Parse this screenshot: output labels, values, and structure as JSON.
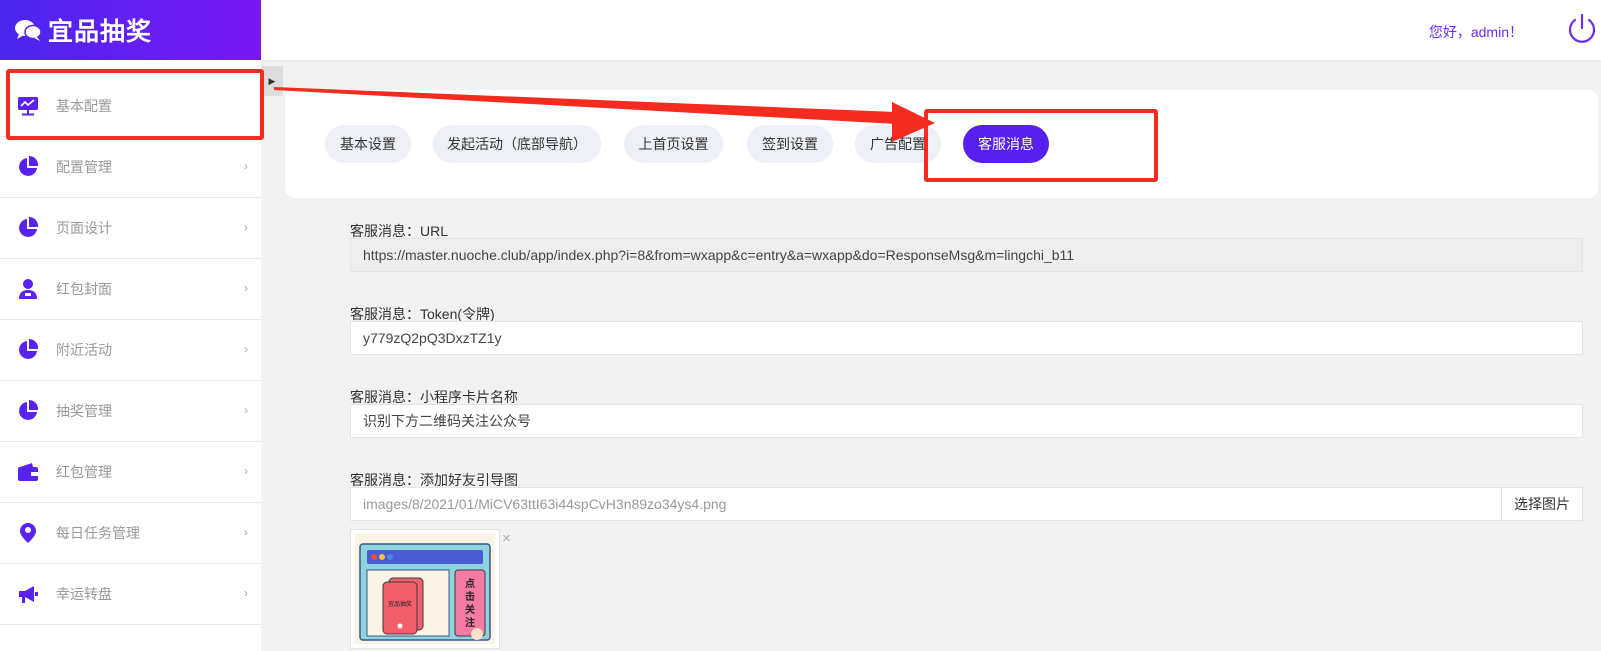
{
  "brand": {
    "title": "宜品抽奖",
    "icon": "chat-bubbles-icon"
  },
  "header": {
    "greeting": "您好，admin！",
    "power_icon": "power-icon"
  },
  "sidebar": {
    "items": [
      {
        "label": "基本配置",
        "icon": "monitor-chart-icon",
        "has_arrow": false
      },
      {
        "label": "配置管理",
        "icon": "pie-chart-icon",
        "has_arrow": true
      },
      {
        "label": "页面设计",
        "icon": "pie-chart-icon",
        "has_arrow": true
      },
      {
        "label": "红包封面",
        "icon": "user-badge-icon",
        "has_arrow": true
      },
      {
        "label": "附近活动",
        "icon": "pie-chart-icon",
        "has_arrow": true
      },
      {
        "label": "抽奖管理",
        "icon": "pie-chart-icon",
        "has_arrow": true
      },
      {
        "label": "红包管理",
        "icon": "wallet-icon",
        "has_arrow": true
      },
      {
        "label": "每日任务管理",
        "icon": "location-user-icon",
        "has_arrow": true
      },
      {
        "label": "幸运转盘",
        "icon": "megaphone-icon",
        "has_arrow": true
      }
    ]
  },
  "tabs": [
    {
      "label": "基本设置",
      "active": false
    },
    {
      "label": "发起活动（底部导航）",
      "active": false
    },
    {
      "label": "上首页设置",
      "active": false
    },
    {
      "label": "签到设置",
      "active": false
    },
    {
      "label": "广告配置",
      "active": false
    },
    {
      "label": "客服消息",
      "active": true
    }
  ],
  "form": {
    "url_label": "客服消息：URL",
    "url_value": "https://master.nuoche.club/app/index.php?i=8&from=wxapp&c=entry&a=wxapp&do=ResponseMsg&m=lingchi_b11",
    "token_label": "客服消息：Token(令牌)",
    "token_value": "y779zQ2pQ3DxzTZ1y",
    "card_label": "客服消息：小程序卡片名称",
    "card_value": "识别下方二维码关注公众号",
    "image_label": "客服消息：添加好友引导图",
    "image_value": "images/8/2021/01/MiCV63ttI63i44spCvH3n89zo34ys4.png",
    "select_button": "选择图片",
    "remove_symbol": "×",
    "thumb_card_text": "宜品抽奖",
    "thumb_side_text": [
      "点",
      "击",
      "关",
      "注"
    ]
  },
  "colors": {
    "accent": "#5620ee",
    "brand_gradient_start": "#4a26ee",
    "brand_gradient_end": "#7a18f5",
    "annotation_red": "#f42b1f"
  }
}
